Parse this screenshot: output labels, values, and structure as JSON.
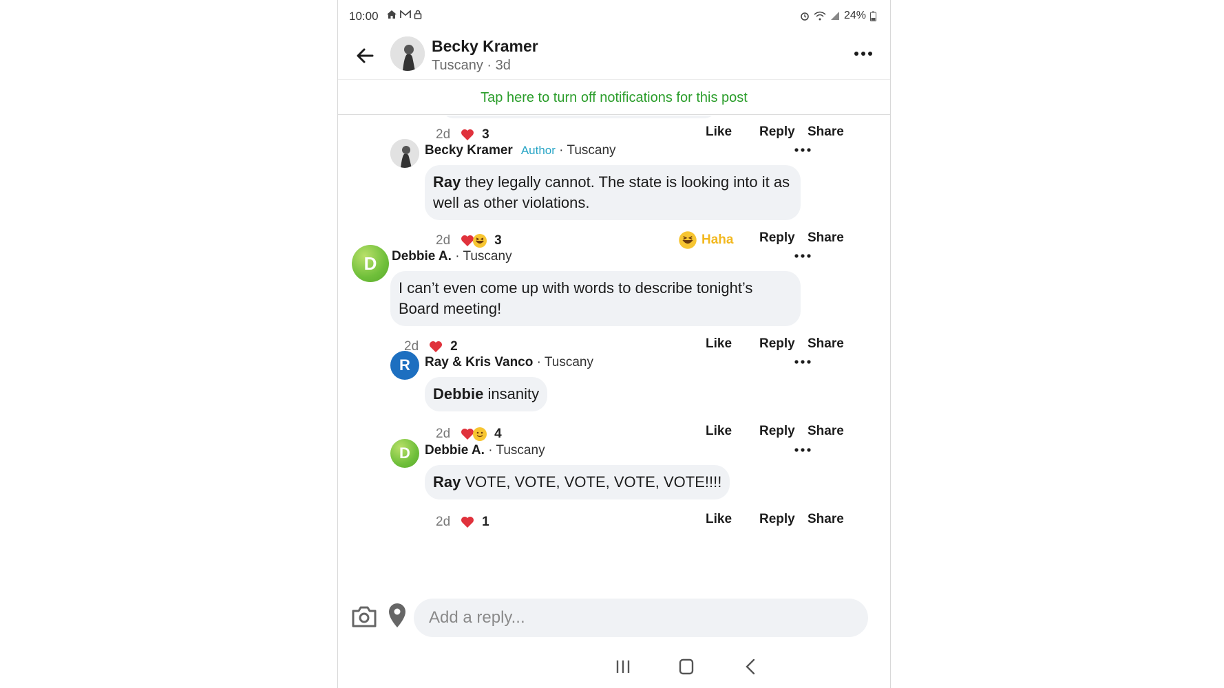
{
  "status_bar": {
    "time": "10:00",
    "battery": "24%"
  },
  "header": {
    "name": "Becky Kramer",
    "location": "Tuscany",
    "age": "3d"
  },
  "notification_banner": "Tap here to turn off notifications for this post",
  "prev_meta": {
    "time": "2d",
    "count": "3",
    "like": "Like",
    "reply": "Reply",
    "share": "Share"
  },
  "comments": [
    {
      "name": "Becky Kramer",
      "badge": "Author",
      "location": "Tuscany",
      "mention": "Ray",
      "text": " they legally cannot. The state is looking into it as well as other violations.",
      "time": "2d",
      "count": "3",
      "like": "Haha",
      "reply": "Reply",
      "share": "Share"
    },
    {
      "name": "Debbie A.",
      "initial": "D",
      "location": "Tuscany",
      "text": "I can’t even come up with words to describe tonight’s Board meeting!",
      "time": "2d",
      "count": "2",
      "like": "Like",
      "reply": "Reply",
      "share": "Share"
    },
    {
      "name": "Ray & Kris Vanco",
      "initial": "R",
      "location": "Tuscany",
      "mention": "Debbie",
      "text": " insanity",
      "time": "2d",
      "count": "4",
      "like": "Like",
      "reply": "Reply",
      "share": "Share"
    },
    {
      "name": "Debbie A.",
      "initial": "D",
      "location": "Tuscany",
      "mention": "Ray",
      "text": " VOTE, VOTE, VOTE, VOTE, VOTE!!!!",
      "time": "2d",
      "count": "1",
      "like": "Like",
      "reply": "Reply",
      "share": "Share"
    }
  ],
  "reply_bar": {
    "placeholder": "Add a reply..."
  },
  "colors": {
    "accent_green": "#2a9d2a",
    "author_badge": "#27a4c5",
    "haha": "#f2b81f",
    "bubble": "#f0f2f5",
    "avatar_blue": "#1d6fc0"
  }
}
